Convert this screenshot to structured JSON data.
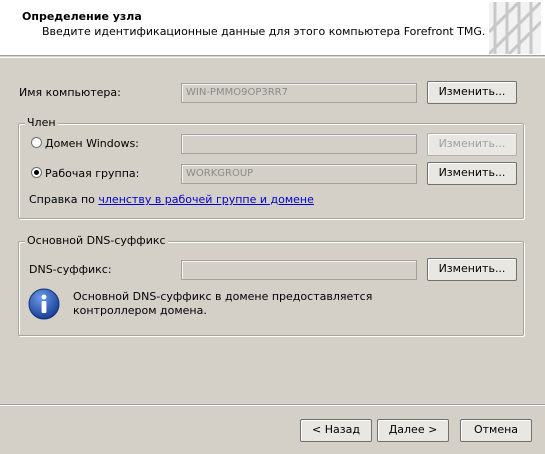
{
  "header": {
    "title": "Определение узла",
    "subtitle": "Введите идентификационные данные для этого компьютера Forefront TMG."
  },
  "computer": {
    "label": "Имя компьютера:",
    "value": "WIN-PMMO9OP3RR7",
    "change_button": "Изменить..."
  },
  "member": {
    "title": "Член",
    "domain_label": "Домен Windows:",
    "domain_value": "",
    "domain_button": "Изменить...",
    "domain_selected": false,
    "workgroup_label": "Рабочая группа:",
    "workgroup_value": "WORKGROUP",
    "workgroup_button": "Изменить...",
    "workgroup_selected": true,
    "help_prefix": "Справка по",
    "help_link": "членству в рабочей группе и домене"
  },
  "dns": {
    "title": "Основной DNS-суффикс",
    "label": "DNS-суффикс:",
    "value": "",
    "change_button": "Изменить...",
    "info_line1": "Основной DNS-суффикс в домене предоставляется",
    "info_line2": "контроллером домена.",
    "info_icon": "info-icon"
  },
  "footer": {
    "back": "< Назад",
    "next": "Далее >",
    "cancel": "Отмена"
  },
  "colors": {
    "background": "#d4d0c8",
    "header_bg": "#ffffff",
    "link": "#0000cc",
    "info_icon": "#1f4fa8"
  }
}
